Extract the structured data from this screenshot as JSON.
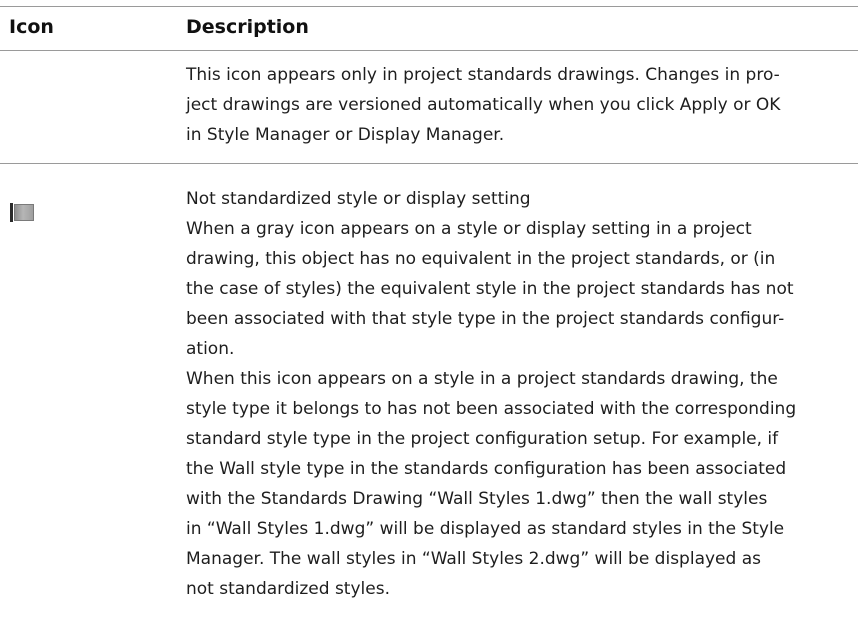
{
  "table": {
    "headers": {
      "icon": "Icon",
      "description": "Description"
    },
    "rows": [
      {
        "icon": "none",
        "lines": [
          "This icon appears only in project standards drawings. Changes in pro-",
          "ject drawings are versioned automatically when you click Apply or OK",
          "in Style Manager or Display Manager."
        ]
      },
      {
        "icon": "gray-square-icon",
        "lines": [
          "Not standardized style or display setting",
          "When a gray icon appears on a style or display setting in a project",
          "drawing, this object has no equivalent in the project standards, or (in",
          "the case of styles) the equivalent style in the project standards has not",
          "been associated with that style type in the project standards configur-",
          "ation.",
          "When this icon appears on a style in a project standards drawing, the",
          "style type it belongs to has not been associated with the corresponding",
          "standard style type in the project configuration setup. For example, if",
          "the Wall style type in the standards configuration has been associated",
          "with the Standards Drawing “Wall Styles 1.dwg” then the wall styles",
          "in “Wall Styles 1.dwg” will be displayed as standard styles in the Style",
          "Manager. The wall styles in “Wall Styles 2.dwg” will be displayed as",
          "not standardized styles."
        ]
      }
    ]
  }
}
